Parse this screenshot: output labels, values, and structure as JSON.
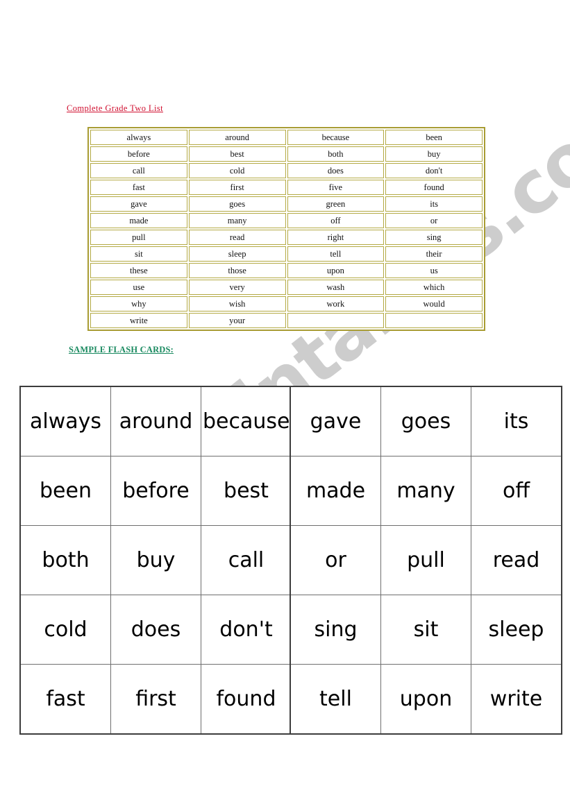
{
  "headings": {
    "list_title": "Complete Grade Two List",
    "flashcards_title": "SAMPLE FLASH CARDS:"
  },
  "watermark": {
    "text": "ESLprintables.com",
    "color": "#c9c9c9"
  },
  "colors": {
    "list_title": "#d01030",
    "flashcards_title": "#1a8a60",
    "word_table_border": "#a89c33",
    "word_cell_border": "#b4aa44",
    "flashcard_outer_border": "#3c3c3c",
    "flashcard_inner_border": "#6e6e6e",
    "page_background": "#ffffff"
  },
  "word_list": {
    "columns": 4,
    "rows": [
      [
        "always",
        "around",
        "because",
        "been"
      ],
      [
        "before",
        "best",
        "both",
        "buy"
      ],
      [
        "call",
        "cold",
        "does",
        "don't"
      ],
      [
        "fast",
        "first",
        "five",
        "found"
      ],
      [
        "gave",
        "goes",
        "green",
        "its"
      ],
      [
        "made",
        "many",
        "off",
        "or"
      ],
      [
        "pull",
        "read",
        "right",
        "sing"
      ],
      [
        "sit",
        "sleep",
        "tell",
        "their"
      ],
      [
        "these",
        "those",
        "upon",
        "us"
      ],
      [
        "use",
        "very",
        "wash",
        "which"
      ],
      [
        "why",
        "wish",
        "work",
        "would"
      ],
      [
        "write",
        "your",
        "",
        ""
      ]
    ]
  },
  "flashcards_left": {
    "rows": [
      [
        "always",
        "around",
        "because"
      ],
      [
        "been",
        "before",
        "best"
      ],
      [
        "both",
        "buy",
        "call"
      ],
      [
        "cold",
        "does",
        "don't"
      ],
      [
        "fast",
        "first",
        "found"
      ]
    ]
  },
  "flashcards_right": {
    "rows": [
      [
        "gave",
        "goes",
        "its"
      ],
      [
        "made",
        "many",
        "off"
      ],
      [
        "or",
        "pull",
        "read"
      ],
      [
        "sing",
        "sit",
        "sleep"
      ],
      [
        "tell",
        "upon",
        "write"
      ]
    ]
  }
}
